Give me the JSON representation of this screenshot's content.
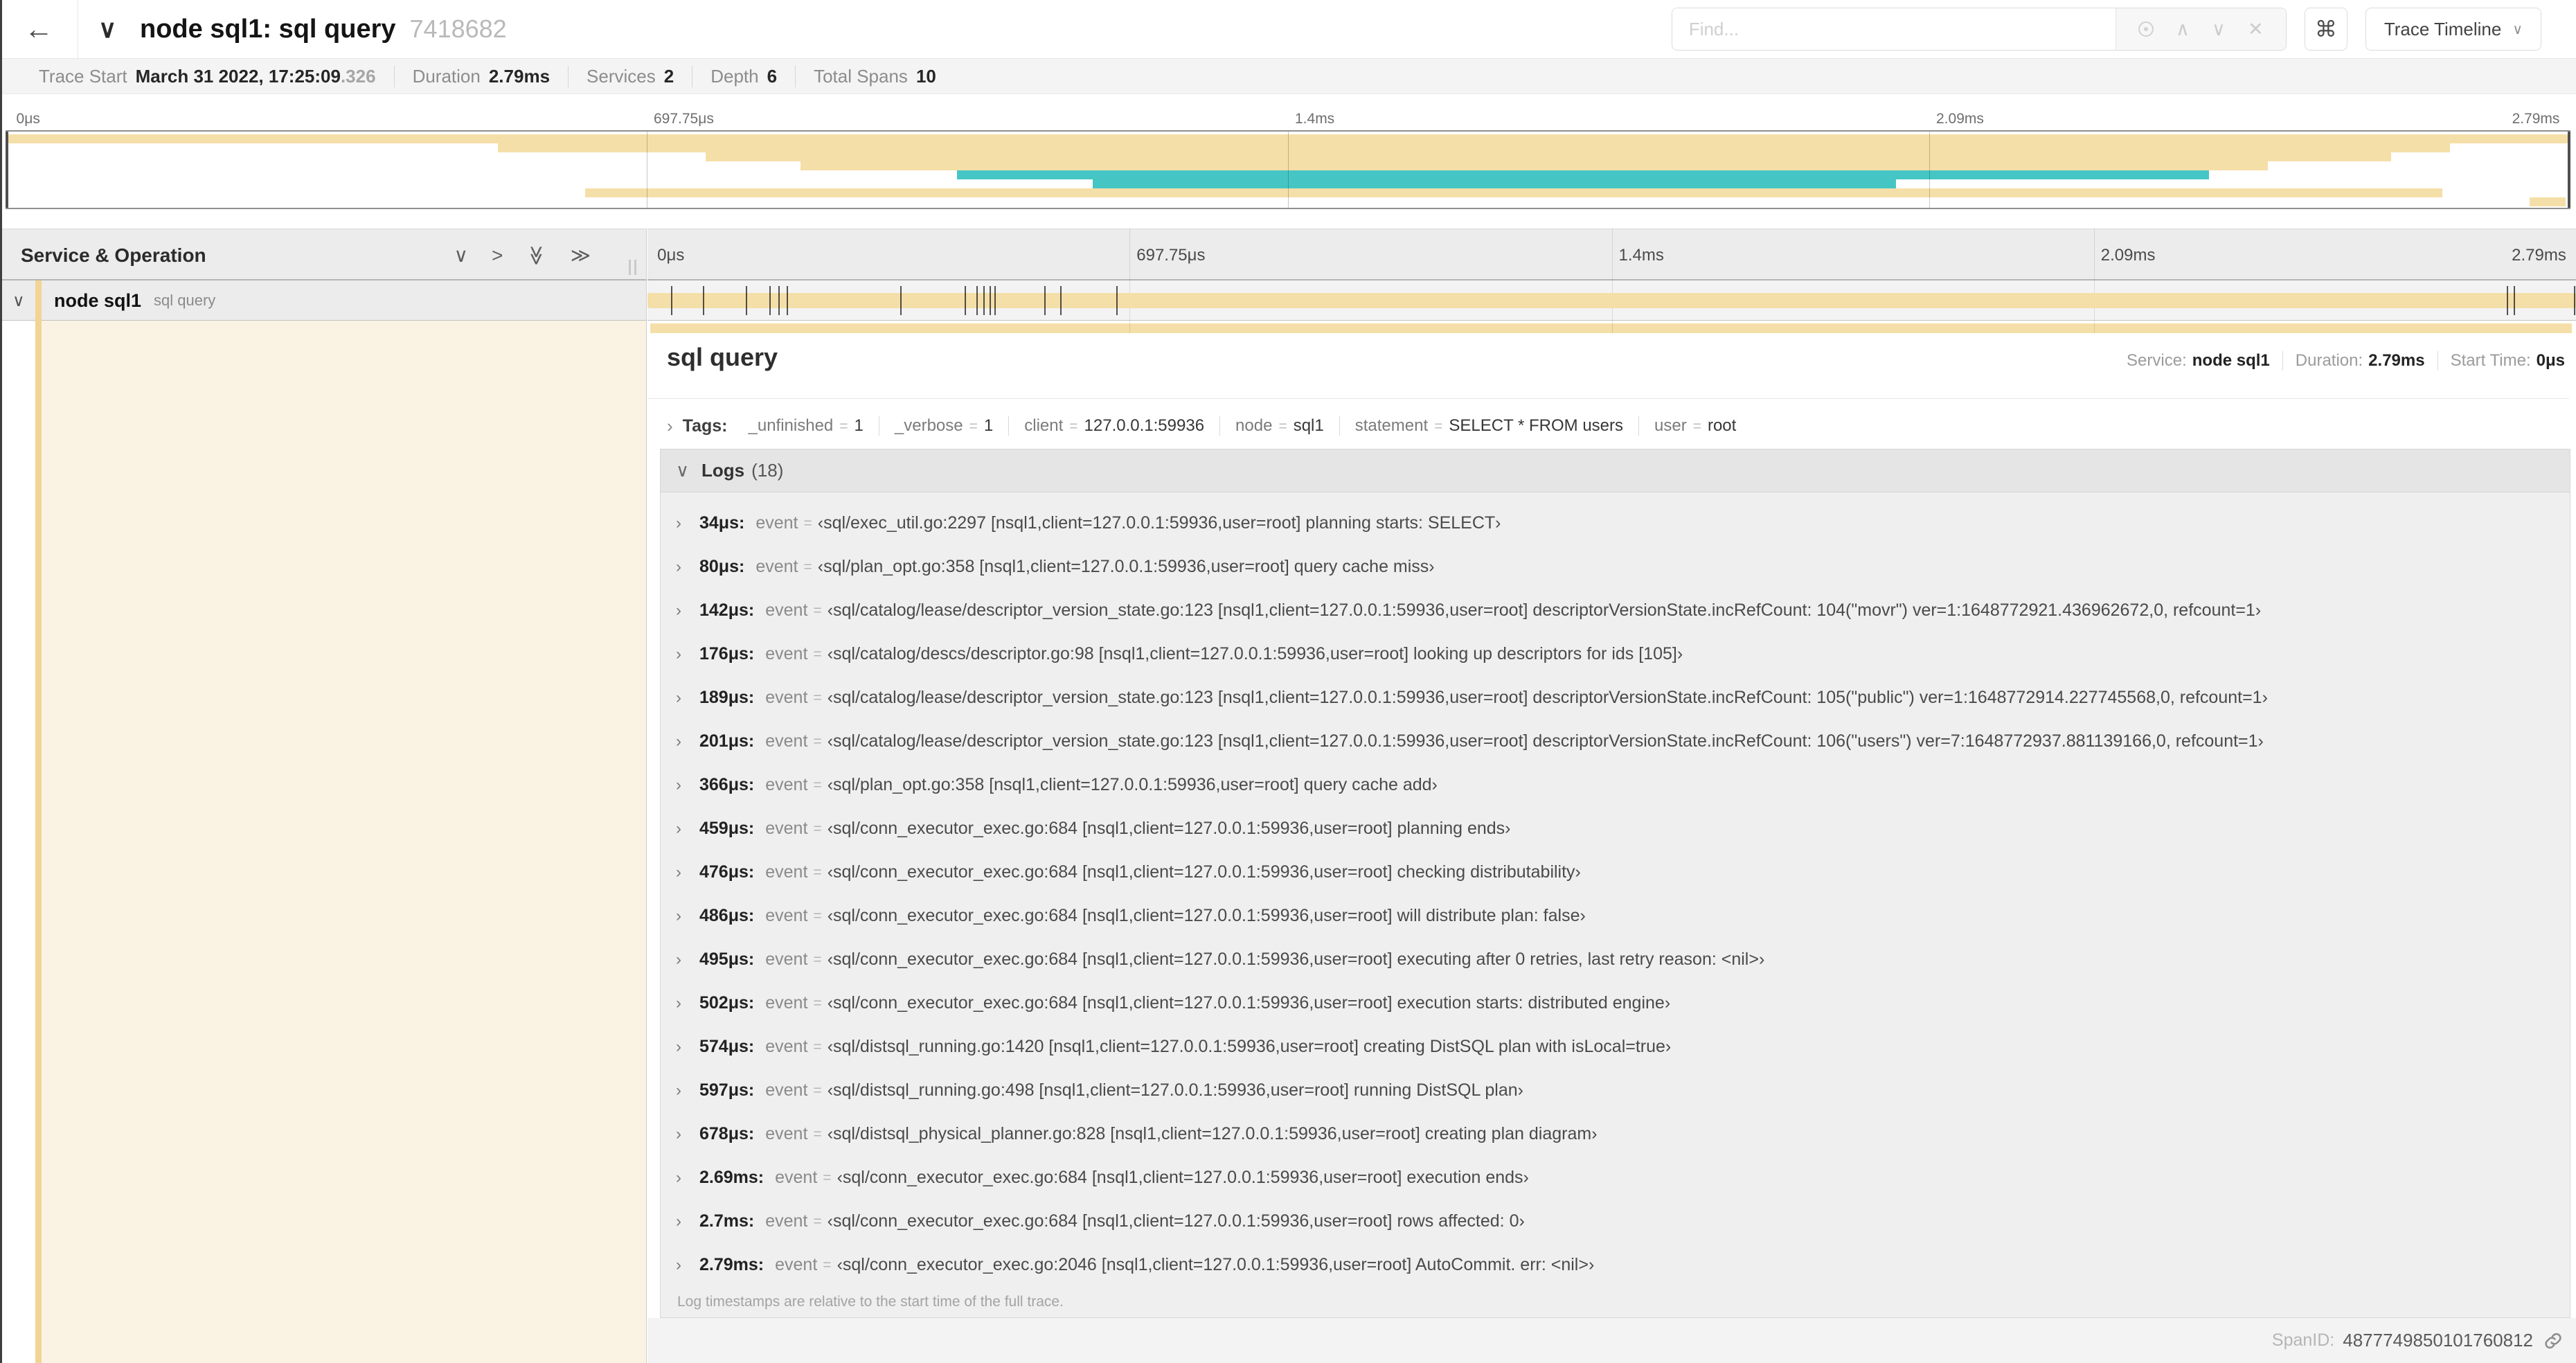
{
  "colors": {
    "beige": "#f5dfa8",
    "teal": "#46c5c5",
    "cream": "#faf3e4",
    "accent": "#f2d494"
  },
  "glyphs": {
    "back": "←",
    "chevron_down": "∨",
    "chevron_right": "›",
    "chevron_up": "∧",
    "close": "✕",
    "command": "⌘",
    "caret": "∨",
    "gt": ">",
    "double_chevron": "≫",
    "eq": "="
  },
  "header": {
    "title": "node sql1: sql query",
    "trace_id": "7418682",
    "find_placeholder": "Find...",
    "view_button": "Trace Timeline"
  },
  "stats": {
    "items": [
      {
        "label": "Trace Start",
        "value": "March 31 2022, 17:25:09",
        "suffix": ".326"
      },
      {
        "label": "Duration",
        "value": "2.79ms"
      },
      {
        "label": "Services",
        "value": "2"
      },
      {
        "label": "Depth",
        "value": "6"
      },
      {
        "label": "Total Spans",
        "value": "10"
      }
    ]
  },
  "ruler_labels": [
    {
      "label": "0μs",
      "pct": 0.15
    },
    {
      "label": "697.75μs",
      "pct": 25
    },
    {
      "label": "1.4ms",
      "pct": 50
    },
    {
      "label": "2.09ms",
      "pct": 75
    },
    {
      "label": "2.79ms",
      "pct": 99.85,
      "align": "right"
    }
  ],
  "grid_pcts": [
    25,
    50,
    75
  ],
  "minimap": {
    "bars": [
      {
        "row": 0,
        "start": 0,
        "end": 100,
        "color": "beige"
      },
      {
        "row": 1,
        "start": 19.2,
        "end": 95.3,
        "color": "beige"
      },
      {
        "row": 2,
        "start": 27.3,
        "end": 93.0,
        "color": "beige"
      },
      {
        "row": 3,
        "start": 31.0,
        "end": 88.2,
        "color": "beige"
      },
      {
        "row": 4,
        "start": 37.1,
        "end": 85.9,
        "color": "teal"
      },
      {
        "row": 5,
        "start": 42.4,
        "end": 73.7,
        "color": "teal"
      },
      {
        "row": 6,
        "start": 22.6,
        "end": 95.0,
        "color": "beige"
      },
      {
        "row": 7,
        "start": 98.4,
        "end": 99.8,
        "color": "beige"
      }
    ]
  },
  "table": {
    "header_title": "Service & Operation",
    "collapse_icons": [
      "∨",
      ">",
      "≫",
      "≫"
    ],
    "row": {
      "service": "node sql1",
      "operation": "sql query"
    },
    "row_bars": [
      {
        "start": 0,
        "end": 100,
        "color": "beige"
      }
    ],
    "ticks": [
      1.22,
      2.87,
      5.09,
      6.31,
      6.77,
      7.2,
      13.12,
      16.45,
      17.06,
      17.42,
      17.74,
      17.99,
      20.57,
      21.4,
      24.3,
      96.42,
      96.77,
      99.9
    ]
  },
  "detail": {
    "title": "sql query",
    "service_label": "Service:",
    "service": "node sql1",
    "duration_label": "Duration:",
    "duration": "2.79ms",
    "start_label": "Start Time:",
    "start": "0μs",
    "tags_label": "Tags:",
    "tags": [
      {
        "key": "_unfinished",
        "value": "1"
      },
      {
        "key": "_verbose",
        "value": "1"
      },
      {
        "key": "client",
        "value": "127.0.0.1:59936"
      },
      {
        "key": "node",
        "value": "sql1"
      },
      {
        "key": "statement",
        "value": "SELECT * FROM users"
      },
      {
        "key": "user",
        "value": "root"
      }
    ],
    "logs_label": "Logs",
    "logs_count": "(18)",
    "logs": [
      {
        "ts": "34μs:",
        "key": "event",
        "value": "‹sql/exec_util.go:2297 [nsql1,client=127.0.0.1:59936,user=root] planning starts: SELECT›"
      },
      {
        "ts": "80μs:",
        "key": "event",
        "value": "‹sql/plan_opt.go:358 [nsql1,client=127.0.0.1:59936,user=root] query cache miss›"
      },
      {
        "ts": "142μs:",
        "key": "event",
        "value": "‹sql/catalog/lease/descriptor_version_state.go:123 [nsql1,client=127.0.0.1:59936,user=root] descriptorVersionState.incRefCount: 104(\"movr\") ver=1:1648772921.436962672,0, refcount=1›"
      },
      {
        "ts": "176μs:",
        "key": "event",
        "value": "‹sql/catalog/descs/descriptor.go:98 [nsql1,client=127.0.0.1:59936,user=root] looking up descriptors for ids [105]›"
      },
      {
        "ts": "189μs:",
        "key": "event",
        "value": "‹sql/catalog/lease/descriptor_version_state.go:123 [nsql1,client=127.0.0.1:59936,user=root] descriptorVersionState.incRefCount: 105(\"public\") ver=1:1648772914.227745568,0, refcount=1›"
      },
      {
        "ts": "201μs:",
        "key": "event",
        "value": "‹sql/catalog/lease/descriptor_version_state.go:123 [nsql1,client=127.0.0.1:59936,user=root] descriptorVersionState.incRefCount: 106(\"users\") ver=7:1648772937.881139166,0, refcount=1›"
      },
      {
        "ts": "366μs:",
        "key": "event",
        "value": "‹sql/plan_opt.go:358 [nsql1,client=127.0.0.1:59936,user=root] query cache add›"
      },
      {
        "ts": "459μs:",
        "key": "event",
        "value": "‹sql/conn_executor_exec.go:684 [nsql1,client=127.0.0.1:59936,user=root] planning ends›"
      },
      {
        "ts": "476μs:",
        "key": "event",
        "value": "‹sql/conn_executor_exec.go:684 [nsql1,client=127.0.0.1:59936,user=root] checking distributability›"
      },
      {
        "ts": "486μs:",
        "key": "event",
        "value": "‹sql/conn_executor_exec.go:684 [nsql1,client=127.0.0.1:59936,user=root] will distribute plan: false›"
      },
      {
        "ts": "495μs:",
        "key": "event",
        "value": "‹sql/conn_executor_exec.go:684 [nsql1,client=127.0.0.1:59936,user=root] executing after 0 retries, last retry reason: <nil>›"
      },
      {
        "ts": "502μs:",
        "key": "event",
        "value": "‹sql/conn_executor_exec.go:684 [nsql1,client=127.0.0.1:59936,user=root] execution starts: distributed engine›"
      },
      {
        "ts": "574μs:",
        "key": "event",
        "value": "‹sql/distsql_running.go:1420 [nsql1,client=127.0.0.1:59936,user=root] creating DistSQL plan with isLocal=true›"
      },
      {
        "ts": "597μs:",
        "key": "event",
        "value": "‹sql/distsql_running.go:498 [nsql1,client=127.0.0.1:59936,user=root] running DistSQL plan›"
      },
      {
        "ts": "678μs:",
        "key": "event",
        "value": "‹sql/distsql_physical_planner.go:828 [nsql1,client=127.0.0.1:59936,user=root] creating plan diagram›"
      },
      {
        "ts": "2.69ms:",
        "key": "event",
        "value": "‹sql/conn_executor_exec.go:684 [nsql1,client=127.0.0.1:59936,user=root] execution ends›"
      },
      {
        "ts": "2.7ms:",
        "key": "event",
        "value": "‹sql/conn_executor_exec.go:684 [nsql1,client=127.0.0.1:59936,user=root] rows affected: 0›"
      },
      {
        "ts": "2.79ms:",
        "key": "event",
        "value": "‹sql/conn_executor_exec.go:2046 [nsql1,client=127.0.0.1:59936,user=root] AutoCommit. err: <nil>›"
      }
    ],
    "footer_note": "Log timestamps are relative to the start time of the full trace.",
    "spanid_label": "SpanID:",
    "spanid": "4877749850101760812"
  }
}
